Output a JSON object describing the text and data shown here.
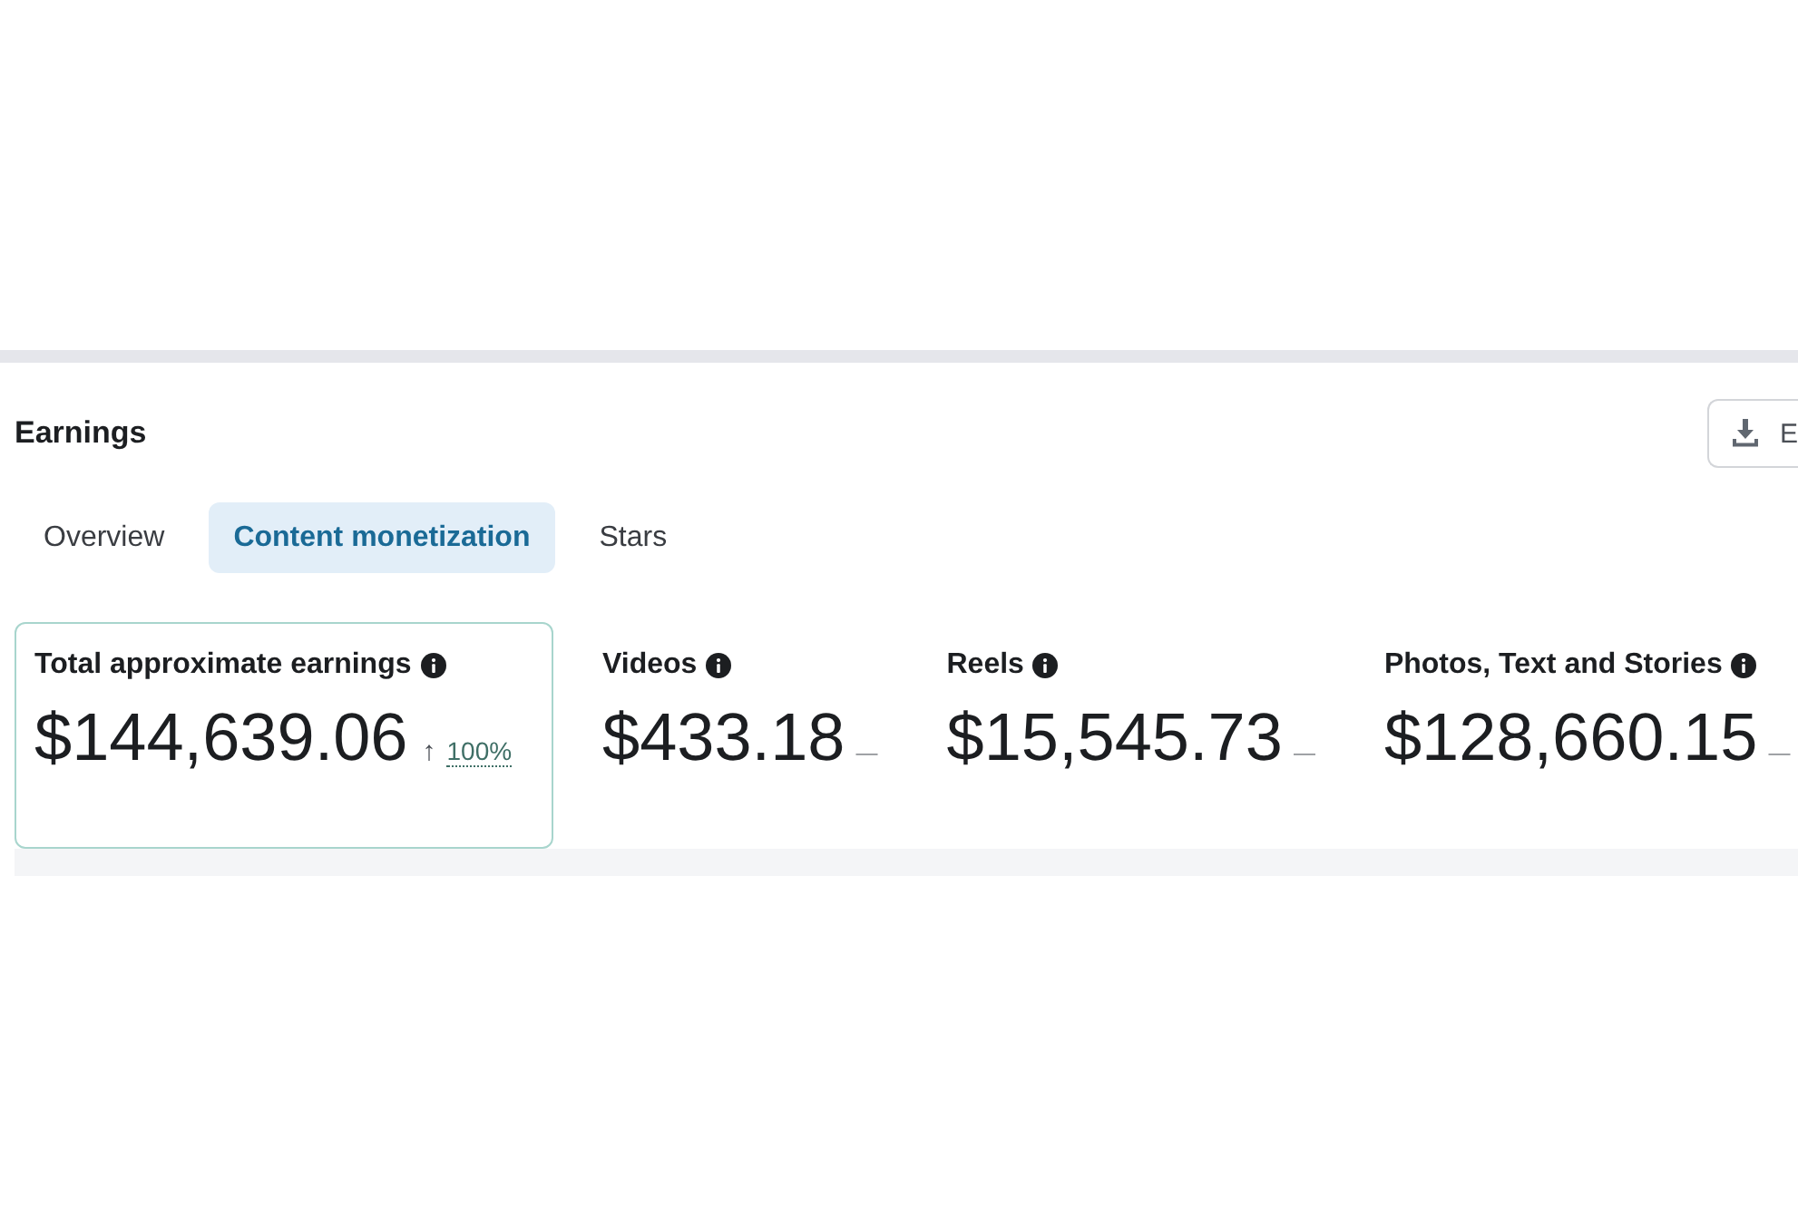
{
  "section": {
    "title": "Earnings",
    "export_button": {
      "label": "E"
    }
  },
  "tabs": [
    {
      "label": "Overview",
      "selected": false
    },
    {
      "label": "Content monetization",
      "selected": true
    },
    {
      "label": "Stars",
      "selected": false
    }
  ],
  "metrics": [
    {
      "label": "Total approximate earnings",
      "value": "$144,639.06",
      "trend": "↑",
      "change": "100%",
      "selected": true
    },
    {
      "label": "Videos",
      "value": "$433.18",
      "change": "—",
      "selected": false
    },
    {
      "label": "Reels",
      "value": "$15,545.73",
      "change": "—",
      "selected": false
    },
    {
      "label": "Photos, Text and Stories",
      "value": "$128,660.15",
      "change": "—",
      "selected": false
    }
  ]
}
